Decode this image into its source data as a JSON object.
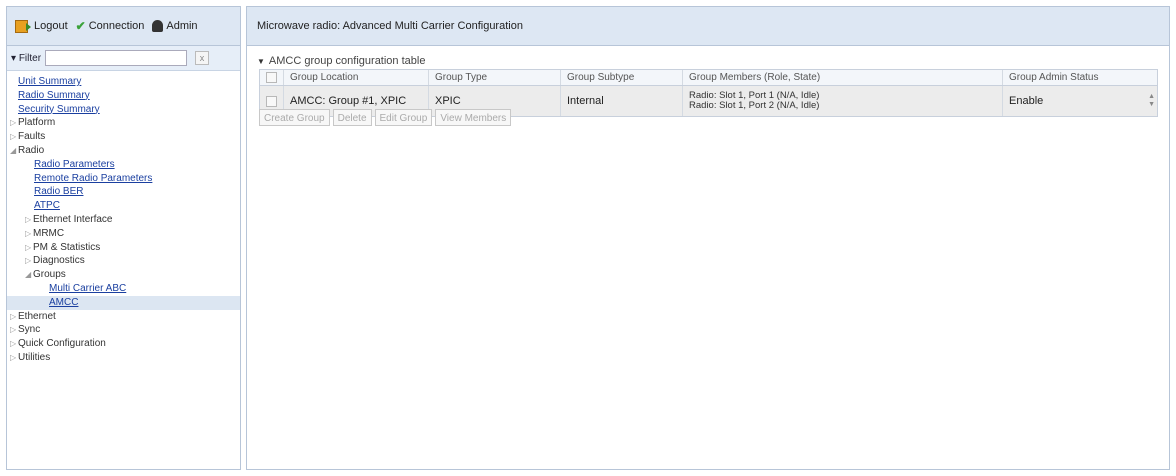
{
  "topbar": {
    "logout": "Logout",
    "connection": "Connection",
    "admin": "Admin"
  },
  "filter": {
    "label": "Filter",
    "value": "",
    "clear": "x"
  },
  "tree": {
    "unit_summary": "Unit Summary",
    "radio_summary": "Radio Summary",
    "security_summary": "Security Summary",
    "platform": "Platform",
    "faults": "Faults",
    "radio": "Radio",
    "radio_parameters": "Radio Parameters",
    "remote_radio_parameters": "Remote Radio Parameters",
    "radio_ber": "Radio BER",
    "atpc": "ATPC",
    "ethernet_interface": "Ethernet Interface",
    "mrmc": "MRMC",
    "pm_statistics": "PM & Statistics",
    "diagnostics": "Diagnostics",
    "groups": "Groups",
    "multi_carrier_abc": "Multi Carrier ABC",
    "amcc": "AMCC",
    "ethernet": "Ethernet",
    "sync": "Sync",
    "quick_configuration": "Quick Configuration",
    "utilities": "Utilities"
  },
  "page": {
    "title": "Microwave radio: Advanced Multi Carrier Configuration",
    "section_title": "AMCC group configuration table"
  },
  "table": {
    "headers": [
      "Group Location",
      "Group Type",
      "Group Subtype",
      "Group Members (Role, State)",
      "Group Admin Status"
    ],
    "row": {
      "location": "AMCC: Group #1, XPIC",
      "type": "XPIC",
      "subtype": "Internal",
      "member1": "Radio: Slot 1, Port 1 (N/A, Idle)",
      "member2": "Radio: Slot 1, Port 2 (N/A, Idle)",
      "admin_status": "Enable"
    }
  },
  "buttons": {
    "create": "Create Group",
    "delete": "Delete",
    "edit": "Edit Group",
    "view": "View Members"
  }
}
